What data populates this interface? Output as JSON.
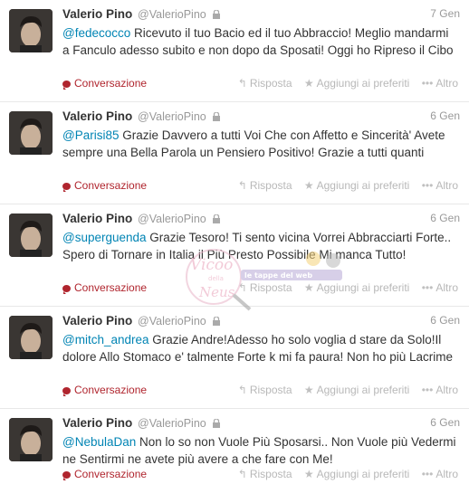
{
  "tweets": [
    {
      "name": "Valerio Pino",
      "handle": "@ValerioPino",
      "date": "7 Gen",
      "mention": "@fedecocco",
      "text": " Ricevuto il tuo Bacio ed il tuo Abbraccio! Meglio mandarmi a Fanculo adesso subito e non dopo da Sposati! Oggi ho Ripreso il Cibo",
      "conversation": "Conversazione",
      "reply": "Risposta",
      "favorite": "Aggiungi ai preferiti",
      "more": "Altro"
    },
    {
      "name": "Valerio Pino",
      "handle": "@ValerioPino",
      "date": "6 Gen",
      "mention": "@Parisi85",
      "text": " Grazie Davvero a tutti Voi Che con Affetto e Sincerità' Avete sempre una Bella Parola un Pensiero Positivo! Grazie a tutti quanti",
      "conversation": "Conversazione",
      "reply": "Risposta",
      "favorite": "Aggiungi ai preferiti",
      "more": "Altro"
    },
    {
      "name": "Valerio Pino",
      "handle": "@ValerioPino",
      "date": "6 Gen",
      "mention": "@superguenda",
      "text": " Grazie Tesoro! Ti sento vicina Vorrei Abbracciarti Forte.. Spero di Tornare in Italia il Più Presto Possibile Mi manca Tutto!",
      "conversation": "Conversazione",
      "reply": "Risposta",
      "favorite": "Aggiungi ai preferiti",
      "more": "Altro"
    },
    {
      "name": "Valerio Pino",
      "handle": "@ValerioPino",
      "date": "6 Gen",
      "mention": "@mitch_andrea",
      "text": " Grazie Andre!Adesso ho solo voglia d stare da Solo!Il dolore Allo Stomaco e' talmente Forte k mi fa paura! Non ho più Lacrime",
      "conversation": "Conversazione",
      "reply": "Risposta",
      "favorite": "Aggiungi ai preferiti",
      "more": "Altro"
    },
    {
      "name": "Valerio Pino",
      "handle": "@ValerioPino",
      "date": "6 Gen",
      "mention": "@NebulaDan",
      "text": " Non lo so non Vuole Più Sposarsi.. Non Vuole più Vedermi ne Sentirmi ne avete più avere a che fare con Me!",
      "conversation": "Conversazione",
      "reply": "Risposta",
      "favorite": "Aggiungi ai preferiti",
      "more": "Altro"
    }
  ],
  "watermark": {
    "line1": "Vicoo",
    "line2": "della",
    "line3": "Neus",
    "tag": "le tappe del web"
  },
  "colors": {
    "link": "#0084b4",
    "conversation": "#b0252e",
    "muted": "#999999"
  }
}
